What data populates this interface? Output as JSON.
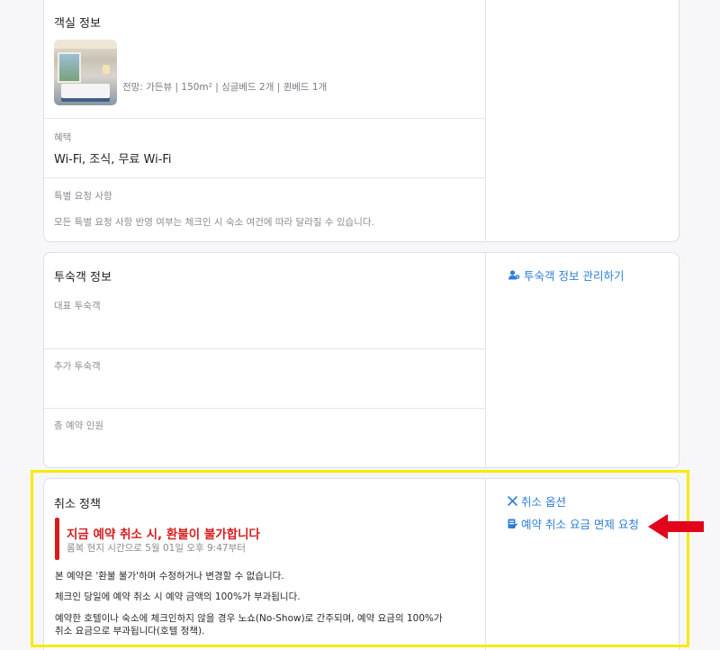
{
  "room_info": {
    "title": "객실 정보",
    "details": "전망: 가든뷰 | 150m² | 싱글베드 2개 | 퀸베드 1개",
    "benefits_label": "혜택",
    "benefits_value": "Wi-Fi, 조식, 무료 Wi-Fi",
    "special_requests_label": "특별 요청 사항",
    "special_requests_note": "모든 특별 요청 사항 반영 여부는 체크인 시 숙소 여건에 따라 달라질 수 있습니다."
  },
  "guest_info": {
    "title": "투숙객 정보",
    "manage_link": "투숙객 정보 관리하기",
    "primary_guest_label": "대표 투숙객",
    "additional_guest_label": "추가 투숙객",
    "total_guests_label": "총 예약 인원"
  },
  "cancellation": {
    "title": "취소 정책",
    "warning_title": "지금 예약 취소 시, 환불이 불가합니다",
    "warning_subtitle": "롬복 현지 시간으로 5월 01일 오후 9:47부터",
    "policy_lines": [
      "본 예약은 '환불 불가'하며 수정하거나 변경할 수 없습니다.",
      "체크인 당일에 예약 취소 시 예약 금액의 100%가 부과됩니다.",
      "예약한 호텔이나 숙소에 체크인하지 않을 경우 노쇼(No-Show)로 간주되며, 예약 요금의 100%가",
      "취소 요금으로 부과됩니다(호텔 정책)."
    ],
    "options_link": "취소 옵션",
    "waiver_link": "예약 취소 요금 면제 요청"
  },
  "colors": {
    "link": "#2f7fd8",
    "warning": "#d71d1d",
    "highlight_border": "#f7ea00",
    "arrow": "#e2061c"
  },
  "icons": {
    "manage_guest": "user-gear-icon",
    "cancel_options": "close-x-icon",
    "waiver_request": "document-edit-icon",
    "annotation": "red-arrow-left-icon"
  }
}
